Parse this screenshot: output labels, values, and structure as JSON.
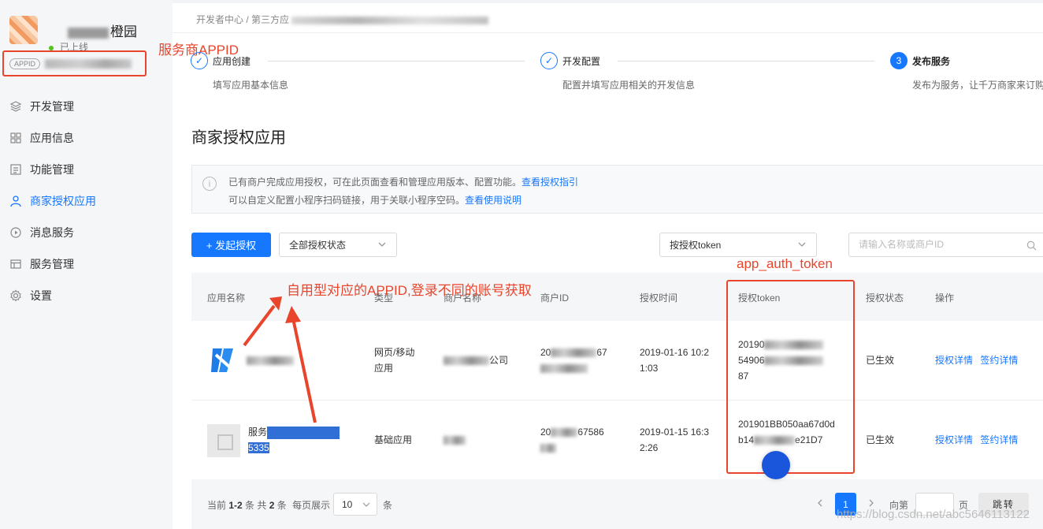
{
  "sidebar": {
    "app_name": "橙园",
    "status": "已上线",
    "appid_tag": "APPID",
    "items": [
      {
        "label": "开发管理",
        "icon": "layers-icon"
      },
      {
        "label": "应用信息",
        "icon": "grid-icon"
      },
      {
        "label": "功能管理",
        "icon": "document-icon"
      },
      {
        "label": "商家授权应用",
        "icon": "user-icon"
      },
      {
        "label": "消息服务",
        "icon": "play-circle-icon"
      },
      {
        "label": "服务管理",
        "icon": "table-icon"
      },
      {
        "label": "设置",
        "icon": "gear-icon"
      }
    ],
    "active_index": 3
  },
  "breadcrumb": {
    "root": "开发者中心",
    "second": "第三方应"
  },
  "steps": [
    {
      "num": "✓",
      "title": "应用创建",
      "desc": "填写应用基本信息"
    },
    {
      "num": "✓",
      "title": "开发配置",
      "desc": "配置并填写应用相关的开发信息"
    },
    {
      "num": "3",
      "title": "发布服务",
      "desc": "发布为服务，让千万商家来订购"
    }
  ],
  "page_title": "商家授权应用",
  "notice": {
    "line1": "已有商户完成应用授权，可在此页面查看和管理应用版本、配置功能。",
    "line1_link": "查看授权指引",
    "line2": "可以自定义配置小程序扫码链接，用于关联小程序空码。",
    "line2_link": "查看使用说明"
  },
  "toolbar": {
    "authorize_button": "+ 发起授权",
    "status_select": "全部授权状态",
    "token_select": "按授权token",
    "search_placeholder": "请输入名称或商户ID"
  },
  "table": {
    "headers": [
      "应用名称",
      "类型",
      "商户名称",
      "商户ID",
      "授权时间",
      "授权token",
      "授权状态",
      "操作"
    ],
    "rows": [
      {
        "name_tail": "",
        "type_line1": "网页/移动",
        "type_line2": "应用",
        "merchant_tail": "公司",
        "merchant_id_a": "20",
        "merchant_id_b": "67",
        "time_line1": "2019-01-16 10:2",
        "time_line2": "1:03",
        "token_line1": "20190",
        "token_line2": "54906",
        "token_line3": "87",
        "status": "已生效",
        "op1": "授权详情",
        "op2": "签约详情"
      },
      {
        "name_head": "服务",
        "name_tail": "5335",
        "type_line1": "基础应用",
        "merchant_tail": "",
        "merchant_id_a": "20",
        "merchant_id_b": "67586",
        "time_line1": "2019-01-15 16:3",
        "time_line2": "2:26",
        "token_line1": "201901BB050aa67d0d",
        "token_line2": "b14",
        "token_line2b": "e21D7",
        "status": "已生效",
        "op1": "授权详情",
        "op2": "签约详情"
      }
    ]
  },
  "footer": {
    "total_prefix": "当前",
    "range": "1-2",
    "total_mid": "条 共",
    "total": "2",
    "total_suffix": "条",
    "per_page_label": "每页展示",
    "per_page": "10",
    "per_page_unit": "条",
    "current_page": "1",
    "goto_prefix": "向第",
    "goto_suffix": "页",
    "goto_button": "跳转"
  },
  "annotations": {
    "appid": "服务商APPID",
    "self_use": "自用型对应的APPID,登录不同的账号获取",
    "token": "app_auth_token"
  },
  "watermark": "https://blog.csdn.net/abc5646113122",
  "colors": {
    "accent": "#1677ff",
    "annotation": "#e8452c",
    "status_online": "#52c41a"
  }
}
